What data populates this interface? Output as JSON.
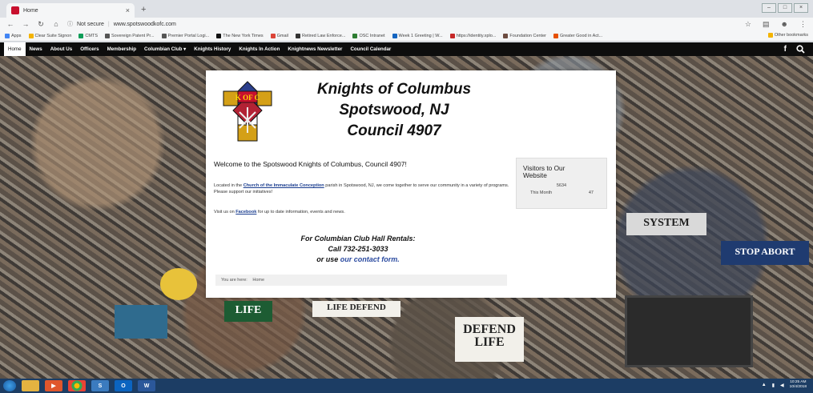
{
  "browser": {
    "tab_title": "Home",
    "tab_close": "×",
    "new_tab": "+",
    "url_security": "Not secure",
    "url": "www.spotswoodkofc.com",
    "bookmarks": [
      {
        "label": "Apps",
        "color": "#4285f4"
      },
      {
        "label": "Clear Suite Signon",
        "color": "#f4b400"
      },
      {
        "label": "CMTS",
        "color": "#0f9d58"
      },
      {
        "label": "Sovereign Patent Pr...",
        "color": "#555555"
      },
      {
        "label": "Premier Portal Logi...",
        "color": "#555555"
      },
      {
        "label": "The New York Times",
        "color": "#111111"
      },
      {
        "label": "Gmail",
        "color": "#db4437"
      },
      {
        "label": "Retired Law Enforce...",
        "color": "#333333"
      },
      {
        "label": "OSC Intranet",
        "color": "#2e7d32"
      },
      {
        "label": "Week 1 Greeting | W...",
        "color": "#1565c0"
      },
      {
        "label": "https://identity.xplo...",
        "color": "#c62828"
      },
      {
        "label": "Foundation Center",
        "color": "#6d4c41"
      },
      {
        "label": "Greater Good in Act...",
        "color": "#e65100"
      }
    ],
    "other_bookmarks": "Other bookmarks"
  },
  "site": {
    "nav": [
      {
        "label": "Home",
        "active": true
      },
      {
        "label": "News"
      },
      {
        "label": "About Us"
      },
      {
        "label": "Officers"
      },
      {
        "label": "Membership"
      },
      {
        "label": "Columbian Club ▾"
      },
      {
        "label": "Knights History"
      },
      {
        "label": "Knights In Action"
      },
      {
        "label": "Knightnews Newsletter"
      },
      {
        "label": "Council Calendar"
      }
    ],
    "social_f": "f",
    "title_line1": "Knights of Columbus",
    "title_line2": "Spotswood, NJ",
    "title_line3": "Council 4907",
    "crest_text": "K OF C",
    "welcome": "Welcome to the Spotswood Knights of Columbus, Council 4907!",
    "para1_pre": "Located in the ",
    "para1_link": "Church of the Immaculate Conception",
    "para1_post": " parish in Spotswood, NJ, we come together to serve our community in a variety of programs.  Please support our initiatives!",
    "para2_pre": "Visit us on ",
    "para2_link": "Facebook",
    "para2_post": " for up to date information, events and news.",
    "rentals_line1": "For Columbian Club Hall Rentals:",
    "rentals_line2": "Call 732-251-3033",
    "rentals_line3_pre": "or use ",
    "rentals_line3_link": "our contact form.",
    "breadcrumb_label": "You are here:",
    "breadcrumb_current": "Home",
    "visitors": {
      "title": "Visitors to Our Website",
      "total": "5634",
      "month_label": "This Month",
      "month_value": "47"
    }
  },
  "signs": {
    "defend_life": "DEFEND LIFE",
    "life_defend": "LIFE DEFEND",
    "stop_abort": "STOP ABORT",
    "system": "SYSTEM",
    "life": "LIFE"
  },
  "taskbar": {
    "clock_time": "10:25 AM",
    "clock_date": "10/4/2018"
  }
}
